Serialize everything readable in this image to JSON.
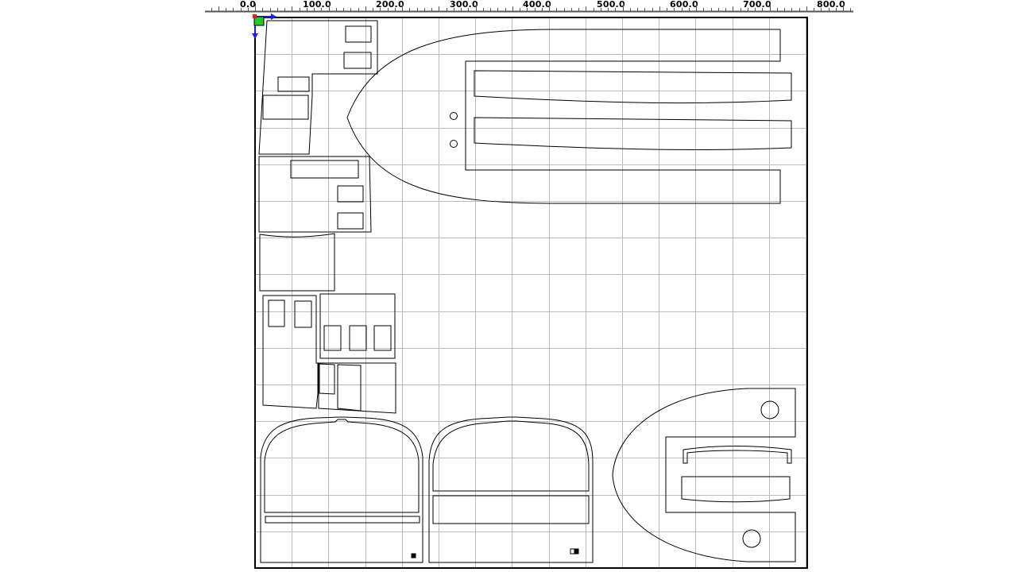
{
  "ruler": {
    "labels": [
      "0.0",
      "100.0",
      "200.0",
      "300.0",
      "400.0",
      "500.0",
      "600.0",
      "700.0",
      "800.0"
    ]
  },
  "colors": {
    "grid": "#bcbcbc",
    "outline": "#000000",
    "ruler_line": "#555555",
    "origin_x_arrow": "#1a1aff",
    "origin_y_arrow": "#1a1aff",
    "origin_marker_fill": "#22cc22",
    "origin_marker_corner": "#e02020"
  },
  "icons": {
    "origin": "origin-axes-icon"
  }
}
